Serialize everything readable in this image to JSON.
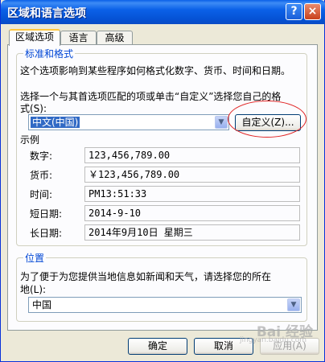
{
  "window": {
    "title": "区域和语言选项",
    "help_label": "?",
    "close_label": "×"
  },
  "tabs": [
    {
      "label": "区域选项",
      "active": true
    },
    {
      "label": "语言",
      "active": false
    },
    {
      "label": "高级",
      "active": false
    }
  ],
  "standards": {
    "group_title": "标准和格式",
    "description": "这个选项影响到某些程序如何格式化数字、货币、时间和日期。",
    "instruction_line1": "选择一个与其首选项匹配的项或单击“自定义”选择您自己的格",
    "instruction_line2": "式(S):",
    "selected_format": "中文(中国)",
    "customize_label": "自定义(Z)..."
  },
  "samples": {
    "heading": "示例",
    "rows": [
      {
        "label": "数字:",
        "value": "123,456,789.00"
      },
      {
        "label": "货币:",
        "value": "￥123,456,789.00"
      },
      {
        "label": "时间:",
        "value": "PM13:51:33"
      },
      {
        "label": "短日期:",
        "value": "2014-9-10"
      },
      {
        "label": "长日期:",
        "value": "2014年9月10日 星期三"
      }
    ]
  },
  "location": {
    "group_title": "位置",
    "instruction_line1": "为了便于为您提供当地信息如新闻和天气，请选择您的所在",
    "instruction_line2": "地(L):",
    "selected_location": "中国"
  },
  "footer": {
    "ok_label": "确定",
    "cancel_label": "取消",
    "apply_label": "应用(A)"
  },
  "watermark": {
    "text": "Bai 经验",
    "sub": "jingyan.baidu.com"
  },
  "colors": {
    "titlebar": "#0552d4",
    "group_title": "#0046d5",
    "selection": "#316ac5",
    "annotation": "#e02020"
  }
}
